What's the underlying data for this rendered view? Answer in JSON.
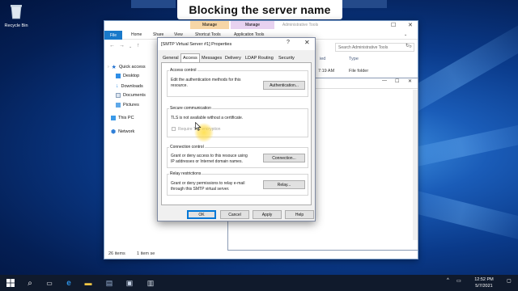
{
  "caption": "Blocking the server name",
  "desktop": {
    "recycle_bin_label": "Recycle Bin"
  },
  "explorer": {
    "context_tabs": [
      "Manage",
      "Manage"
    ],
    "context_title": "Administrative Tools",
    "ribbon_tabs": [
      "File",
      "Home",
      "Share",
      "View",
      "Shortcut Tools",
      "Application Tools"
    ],
    "search_placeholder": "Search Administrative Tools",
    "nav_items": [
      "Quick access",
      "Desktop",
      "Downloads",
      "Documents",
      "Pictures",
      "This PC",
      "Network"
    ],
    "column_headers": [
      "ied",
      "Type"
    ],
    "row": {
      "date_fragment": "7:19 AM",
      "type": "File folder"
    },
    "status_items": "26 items",
    "status_selected": "1 item se"
  },
  "dialog": {
    "title": "[SMTP Virtual Server #1] Properties",
    "help_glyph": "?",
    "close_glyph": "✕",
    "tabs": [
      "General",
      "Access",
      "Messages",
      "Delivery",
      "LDAP Routing",
      "Security"
    ],
    "active_tab": "Access",
    "groups": {
      "access_control": {
        "title": "Access control",
        "text": "Edit the authentication methods for this\nresource.",
        "button": "Authentication..."
      },
      "secure_communication": {
        "title": "Secure communication",
        "text": "TLS is not available without a certificate.",
        "checkbox_label": "Require TLS encryption",
        "checked": false
      },
      "connection_control": {
        "title": "Connection control",
        "text": "Grant or deny access to this resouce using\nIP addresses or Internet domain names.",
        "button": "Connection..."
      },
      "relay_restrictions": {
        "title": "Relay restrictions",
        "text": "Grant or deny permissions to relay e-mail\nthrough this SMTP virtual server.",
        "button": "Relay..."
      }
    },
    "footer_buttons": [
      "OK",
      "Cancel",
      "Apply",
      "Help"
    ]
  },
  "taskbar": {
    "time": "12:52 PM",
    "date": "5/7/2021"
  },
  "colors": {
    "accent": "#0078d7",
    "taskbar": "#101a2c",
    "file_tab": "#1979ca"
  }
}
